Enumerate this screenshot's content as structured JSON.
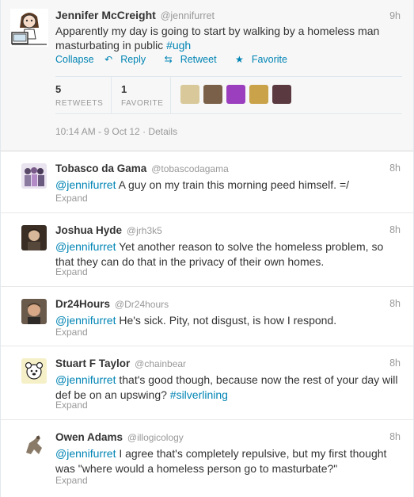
{
  "main_tweet": {
    "fullname": "Jennifer McCreight",
    "username": "@jennifurret",
    "time": "9h",
    "text": "Apparently my day is going to start by walking by a homeless man masturbating in public ",
    "hashtag": "#ugh",
    "actions": {
      "collapse": "Collapse",
      "reply": "Reply",
      "retweet": "Retweet",
      "favorite": "Favorite"
    },
    "retweets_count": "5",
    "retweets_label": "RETWEETS",
    "favorites_count": "1",
    "favorites_label": "FAVORITE",
    "timestamp": "10:14 AM - 9 Oct 12",
    "details": "Details"
  },
  "replies": [
    {
      "fullname": "Tobasco da Gama",
      "username": "@tobascodagama",
      "time": "8h",
      "mention": "@jennifurret",
      "text": " A guy on my train this morning peed himself. =/",
      "hashtag": "",
      "expand": "Expand",
      "avatar_color": "#b9a7c8"
    },
    {
      "fullname": "Joshua Hyde",
      "username": "@jrh3k5",
      "time": "8h",
      "mention": "@jennifurret",
      "text": " Yet another reason to solve the homeless problem, so that they can do that in the privacy of their own homes.",
      "hashtag": "",
      "expand": "Expand",
      "avatar_color": "#6b5a4a"
    },
    {
      "fullname": "Dr24Hours",
      "username": "@Dr24hours",
      "time": "8h",
      "mention": "@jennifurret",
      "text": " He's sick. Pity, not disgust, is how I respond.",
      "hashtag": "",
      "expand": "Expand",
      "avatar_color": "#8a7060"
    },
    {
      "fullname": "Stuart F Taylor",
      "username": "@chainbear",
      "time": "8h",
      "mention": "@jennifurret",
      "text": " that's good though, because now the rest of your day will def be on an upswing? ",
      "hashtag": "#silverlining",
      "expand": "Expand",
      "avatar_color": "#f2ecc0"
    },
    {
      "fullname": "Owen Adams",
      "username": "@illogicology",
      "time": "8h",
      "mention": "@jennifurret",
      "text": " I agree that's completely repulsive, but my first thought was \"where would a homeless person go to masturbate?\"",
      "hashtag": "",
      "expand": "Expand",
      "avatar_color": "#a89a88"
    }
  ]
}
